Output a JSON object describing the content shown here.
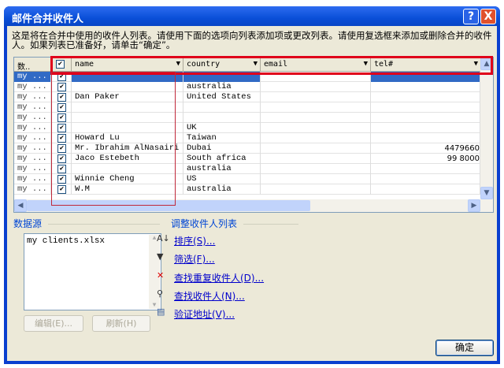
{
  "window": {
    "title": "邮件合并收件人",
    "help": "?",
    "close": "X"
  },
  "description": "这是将在合并中使用的收件人列表。请使用下面的选项向列表添加项或更改列表。请使用复选框来添加或删除合并的收件人。如果列表已准备好，请单击“确定”。",
  "table": {
    "columns": {
      "source": "数..",
      "name": "name",
      "country": "country",
      "email": "email",
      "tel": "tel#"
    },
    "rows": [
      {
        "source": "my ...",
        "name": "",
        "country": "",
        "email": "",
        "tel": "",
        "selected": true
      },
      {
        "source": "my ...",
        "name": "",
        "country": "australia",
        "email": "",
        "tel": ""
      },
      {
        "source": "my ...",
        "name": "Dan Paker",
        "country": "United States",
        "email": "",
        "tel": ""
      },
      {
        "source": "my ...",
        "name": "",
        "country": "",
        "email": "",
        "tel": ""
      },
      {
        "source": "my ...",
        "name": "",
        "country": "",
        "email": "",
        "tel": ""
      },
      {
        "source": "my ...",
        "name": "",
        "country": "UK",
        "email": "",
        "tel": ""
      },
      {
        "source": "my ...",
        "name": "Howard Lu",
        "country": "Taiwan",
        "email": "",
        "tel": ""
      },
      {
        "source": "my ...",
        "name": "Mr. Ibrahim AlNasairi",
        "country": "Dubai",
        "email": "",
        "tel": "4479660"
      },
      {
        "source": "my ...",
        "name": "Jaco Estebeth",
        "country": "South africa",
        "email": "",
        "tel": "99 8000"
      },
      {
        "source": "my ...",
        "name": "",
        "country": "australia",
        "email": "",
        "tel": ""
      },
      {
        "source": "my ...",
        "name": "Winnie Cheng",
        "country": "US",
        "email": "",
        "tel": ""
      },
      {
        "source": "my ...",
        "name": "W.M",
        "country": "australia",
        "email": "",
        "tel": ""
      }
    ]
  },
  "datasource": {
    "label": "数据源",
    "items": [
      "my clients.xlsx"
    ],
    "edit": "编辑(E)...",
    "refresh": "刷新(H)"
  },
  "refine": {
    "label": "调整收件人列表",
    "links": [
      {
        "label": "排序(S)...",
        "icon": "sort-icon"
      },
      {
        "label": "筛选(F)...",
        "icon": "filter-icon"
      },
      {
        "label": "查找重复收件人(D)...",
        "icon": "duplicates-icon"
      },
      {
        "label": "查找收件人(N)...",
        "icon": "find-recipient-icon"
      },
      {
        "label": "验证地址(V)...",
        "icon": "validate-icon"
      }
    ]
  },
  "ok": "确定",
  "colors": {
    "title": "#0a4fd8",
    "selection": "#316ac5",
    "highlight": "#e0001a"
  }
}
